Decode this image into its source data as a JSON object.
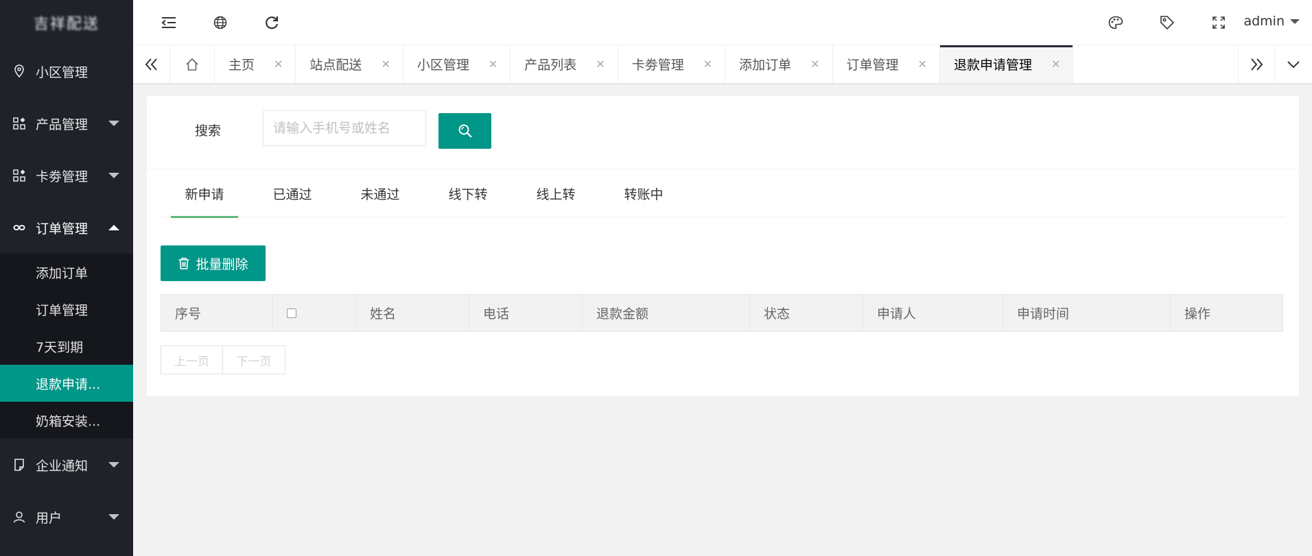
{
  "app": {
    "logo_text": "吉祥配送"
  },
  "sidebar": {
    "items": [
      {
        "label": "小区管理",
        "icon": "location-icon",
        "expandable": false
      },
      {
        "label": "产品管理",
        "icon": "apps-icon",
        "expandable": true
      },
      {
        "label": "卡劵管理",
        "icon": "apps-icon",
        "expandable": true
      },
      {
        "label": "订单管理",
        "icon": "link-icon",
        "expandable": true,
        "open": true
      },
      {
        "label": "企业通知",
        "icon": "note-icon",
        "expandable": true
      },
      {
        "label": "用户",
        "icon": "user-icon",
        "expandable": true
      }
    ],
    "subitems": [
      "添加订单",
      "订单管理",
      "7天到期",
      "退款申请...",
      "奶箱安装..."
    ]
  },
  "header": {
    "user": "admin",
    "icons": [
      "menu-shrink-icon",
      "globe-icon",
      "refresh-icon",
      "theme-palette-icon",
      "tag-icon",
      "fullscreen-icon"
    ]
  },
  "tabs": {
    "items": [
      "主页",
      "站点配送",
      "小区管理",
      "产品列表",
      "卡劵管理",
      "添加订单",
      "订单管理",
      "退款申请管理"
    ],
    "active": "退款申请管理"
  },
  "search": {
    "label": "搜索",
    "placeholder": "请输入手机号或姓名"
  },
  "status_tabs": [
    "新申请",
    "已通过",
    "未通过",
    "线下转",
    "线上转",
    "转账中"
  ],
  "batch_delete_label": "批量删除",
  "table": {
    "headers": [
      "序号",
      "",
      "姓名",
      "电话",
      "退款金额",
      "状态",
      "申请人",
      "申请时间",
      "操作"
    ]
  },
  "pager": {
    "prev": "上一页",
    "next": "下一页"
  },
  "colors": {
    "sidebar_bg": "#20222a",
    "accent": "#009688",
    "tab_underline": "#5fb878"
  }
}
